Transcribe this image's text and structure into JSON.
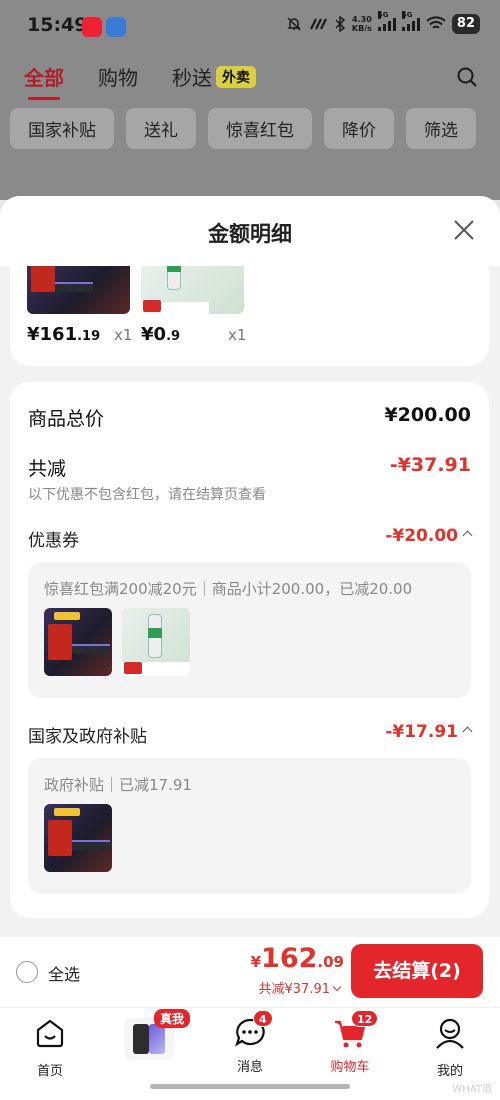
{
  "status_bar": {
    "time": "15:49",
    "net_speed_top": "4.30",
    "net_speed_bottom": "KB/s",
    "sig1": "5G",
    "sig2": "5G",
    "battery": "82"
  },
  "top_tabs": [
    {
      "label": "全部",
      "active": true
    },
    {
      "label": "购物",
      "active": false
    },
    {
      "label": "秒送",
      "active": false
    }
  ],
  "takeout_tag": "外卖",
  "filter_chips": [
    "国家补贴",
    "送礼",
    "惊喜红包",
    "降价",
    "筛选"
  ],
  "sheet": {
    "title": "金额明细",
    "items": [
      {
        "price_int": "¥161",
        "price_dec": ".19",
        "qty": "x1",
        "image": "keyboard-product"
      },
      {
        "price_int": "¥0",
        "price_dec": ".9",
        "qty": "x1",
        "image": "glue-stick-product"
      }
    ],
    "summary": {
      "total_label": "商品总价",
      "total_value": "¥200.00",
      "reduce_label": "共减",
      "reduce_value": "-¥37.91",
      "reduce_note": "以下优惠不包含红包，请在结算页查看",
      "coupon_label": "优惠券",
      "coupon_value": "-¥20.00",
      "coupon_detail": "惊喜红包满200减20元｜商品小计200.00，已减20.00",
      "subsidy_label": "国家及政府补贴",
      "subsidy_value": "-¥17.91",
      "subsidy_detail": "政府补贴｜已减17.91"
    }
  },
  "bottom_bar": {
    "select_all": "全选",
    "total_currency": "¥",
    "total_int": "162",
    "total_dec": ".09",
    "reduce_text": "共减¥37.91",
    "checkout_label": "去结算(2)"
  },
  "nav": [
    {
      "label": "首页",
      "icon": "home-icon"
    },
    {
      "label": "",
      "icon": "phone-promo"
    },
    {
      "label": "消息",
      "icon": "message-icon",
      "badge": "4"
    },
    {
      "label": "购物车",
      "icon": "cart-icon",
      "badge": "12",
      "active": true
    },
    {
      "label": "我的",
      "icon": "profile-icon"
    }
  ],
  "phone_promo_tag": "真我",
  "watermark": "WHAT值",
  "colors": {
    "accent_red": "#e3262c",
    "price_red": "#e0332b",
    "tab_red": "#b0202a"
  }
}
